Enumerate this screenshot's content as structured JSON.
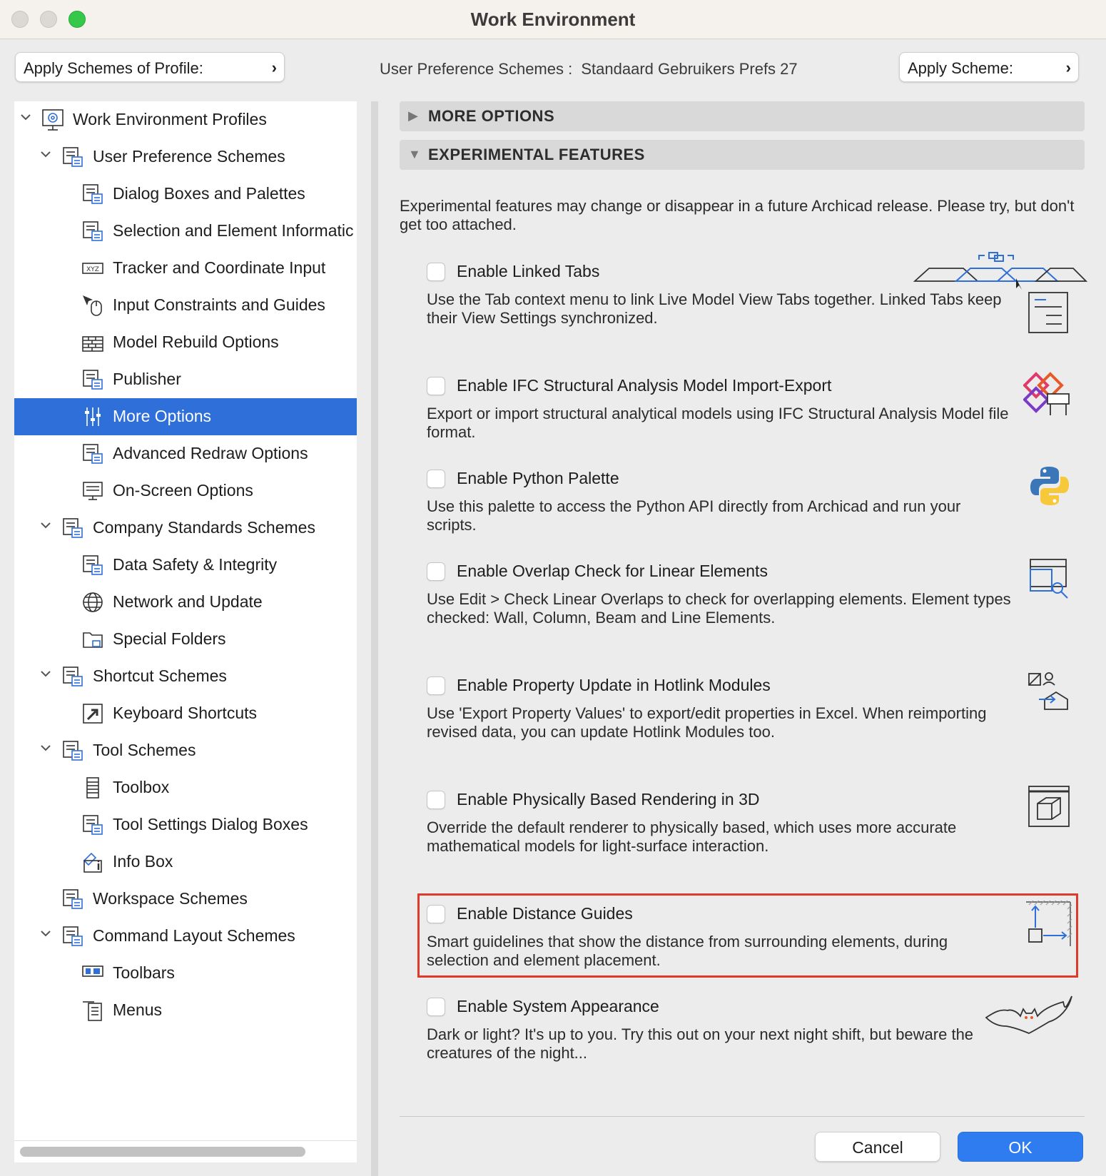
{
  "window": {
    "title": "Work Environment",
    "accent_color": "#2f6fd9",
    "highlight_color": "#e0392b"
  },
  "toolbar": {
    "apply_profile_label": "Apply Schemes of Profile:",
    "user_pref_label": "User Preference Schemes :",
    "user_pref_value": "Standaard Gebruikers Prefs 27",
    "apply_scheme_label": "Apply Scheme:",
    "chevron": "›"
  },
  "tree": {
    "items": [
      {
        "label": "Work Environment Profiles",
        "icon": "profiles-icon",
        "expanded": true
      },
      {
        "label": "User Preference Schemes",
        "icon": "user-prefs-icon",
        "expanded": true
      },
      {
        "label": "Dialog Boxes and Palettes",
        "icon": "dialog-boxes-icon"
      },
      {
        "label": "Selection and Element Informatic",
        "icon": "selection-info-icon"
      },
      {
        "label": "Tracker and Coordinate Input",
        "icon": "xyz-icon"
      },
      {
        "label": "Input Constraints and Guides",
        "icon": "mouse-icon"
      },
      {
        "label": "Model Rebuild Options",
        "icon": "brick-wall-icon"
      },
      {
        "label": "Publisher",
        "icon": "publisher-icon"
      },
      {
        "label": "More Options",
        "icon": "sliders-icon",
        "selected": true
      },
      {
        "label": "Advanced Redraw Options",
        "icon": "redraw-house-icon"
      },
      {
        "label": "On-Screen Options",
        "icon": "monitor-icon"
      },
      {
        "label": "Company Standards Schemes",
        "icon": "company-standards-icon",
        "expanded": true
      },
      {
        "label": "Data Safety & Integrity",
        "icon": "data-safety-icon"
      },
      {
        "label": "Network and Update",
        "icon": "globe-icon"
      },
      {
        "label": "Special Folders",
        "icon": "folder-icon"
      },
      {
        "label": "Shortcut Schemes",
        "icon": "shortcut-schemes-icon",
        "expanded": true
      },
      {
        "label": "Keyboard Shortcuts",
        "icon": "keyboard-shortcut-icon"
      },
      {
        "label": "Tool Schemes",
        "icon": "tool-schemes-icon",
        "expanded": true
      },
      {
        "label": "Toolbox",
        "icon": "toolbox-icon"
      },
      {
        "label": "Tool Settings Dialog Boxes",
        "icon": "tool-settings-icon"
      },
      {
        "label": "Info Box",
        "icon": "info-box-icon"
      },
      {
        "label": "Workspace Schemes",
        "icon": "workspace-icon"
      },
      {
        "label": "Command Layout Schemes",
        "icon": "command-layout-icon",
        "expanded": true
      },
      {
        "label": "Toolbars",
        "icon": "toolbars-icon"
      },
      {
        "label": "Menus",
        "icon": "menus-icon"
      }
    ]
  },
  "sections": {
    "more_options": "MORE OPTIONS",
    "experimental": "EXPERIMENTAL FEATURES"
  },
  "intro_text": "Experimental features may change or disappear in a future Archicad release. Please try, but don't get too attached.",
  "features": [
    {
      "title": "Enable Linked Tabs",
      "desc": "Use the Tab context menu to link Live Model View Tabs together. Linked Tabs keep their View Settings synchronized.",
      "checked": false,
      "icon": "linked-tabs-icon"
    },
    {
      "title": "Enable IFC Structural Analysis Model Import-Export",
      "desc": "Export or import structural analytical models using IFC Structural Analysis Model file format.",
      "checked": false,
      "icon": "ifc-icon"
    },
    {
      "title": "Enable Python Palette",
      "desc": "Use this palette to access the Python API directly from Archicad and run your scripts.",
      "checked": false,
      "icon": "python-icon"
    },
    {
      "title": "Enable Overlap Check for Linear Elements",
      "desc": "Use Edit > Check Linear Overlaps to check for overlapping elements. Element types checked: Wall, Column, Beam and Line Elements.",
      "checked": false,
      "icon": "overlap-check-icon"
    },
    {
      "title": "Enable Property Update in Hotlink Modules",
      "desc": "Use 'Export Property Values' to export/edit properties in Excel. When reimporting revised data, you can update Hotlink Modules too.",
      "checked": false,
      "icon": "property-update-icon"
    },
    {
      "title": "Enable Physically Based Rendering in 3D",
      "desc": "Override the default renderer to physically based, which uses more accurate mathematical models for light-surface interaction.",
      "checked": false,
      "icon": "cube-render-icon"
    },
    {
      "title": "Enable Distance Guides",
      "desc": "Smart guidelines that show the distance from surrounding elements, during selection and element placement.",
      "checked": false,
      "icon": "distance-guides-icon",
      "highlighted": true
    },
    {
      "title": "Enable System Appearance",
      "desc": "Dark or light? It's up to you. Try this out on your next night shift, but beware the creatures of the night...",
      "checked": false,
      "icon": "bat-icon"
    }
  ],
  "buttons": {
    "cancel": "Cancel",
    "ok": "OK"
  }
}
